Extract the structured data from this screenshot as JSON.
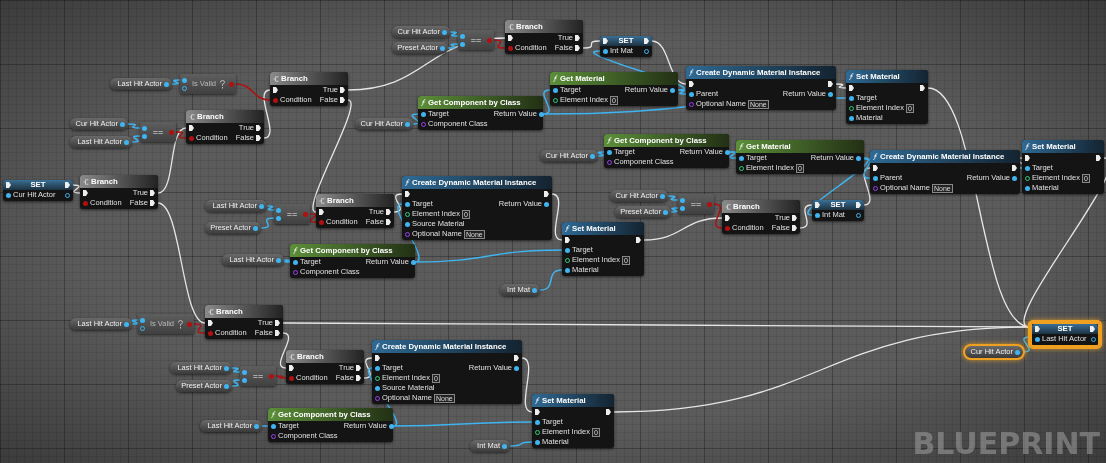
{
  "graph": {
    "nodes": [
      {
        "kind": "variable",
        "label": "Last Hit Actor",
        "selected": false
      },
      {
        "kind": "is_valid",
        "label": "Is Valid",
        "selected": false
      },
      {
        "kind": "variable",
        "label": "Cur Hit Actor",
        "selected": false
      },
      {
        "kind": "variable",
        "label": "Last Hit Actor",
        "selected": false
      },
      {
        "kind": "compare",
        "label": "==",
        "selected": false
      },
      {
        "kind": "branch",
        "title": "Branch",
        "condition": "Condition",
        "true": "True",
        "false": "False",
        "selected": false
      },
      {
        "kind": "branch",
        "title": "Branch",
        "condition": "Condition",
        "true": "True",
        "false": "False",
        "selected": false
      },
      {
        "kind": "set",
        "title": "SET",
        "pin": "Cur Hit Actor",
        "selected": false
      },
      {
        "kind": "branch",
        "title": "Branch",
        "condition": "Condition",
        "true": "True",
        "false": "False",
        "selected": false
      },
      {
        "kind": "variable",
        "label": "Cur Hit Actor",
        "selected": false
      },
      {
        "kind": "variable",
        "label": "Preset Actor",
        "selected": false
      },
      {
        "kind": "compare",
        "label": "==",
        "selected": false
      },
      {
        "kind": "branch",
        "title": "Branch",
        "condition": "Condition",
        "true": "True",
        "false": "False",
        "selected": false
      },
      {
        "kind": "set",
        "title": "SET",
        "pin": "Int Mat",
        "selected": false
      },
      {
        "kind": "variable",
        "label": "Cur Hit Actor",
        "selected": false
      },
      {
        "kind": "function",
        "title": "Get Component by Class",
        "pure": true,
        "selected": false,
        "inputs": [
          {
            "label": "Target",
            "kind": "object"
          },
          {
            "label": "Component Class",
            "kind": "class"
          }
        ],
        "outputs": [
          {
            "label": "Return Value",
            "kind": "object"
          }
        ]
      },
      {
        "kind": "function",
        "title": "Get Material",
        "pure": true,
        "selected": false,
        "inputs": [
          {
            "label": "Target",
            "kind": "object"
          },
          {
            "label": "Element Index",
            "kind": "int",
            "value": "0"
          }
        ],
        "outputs": [
          {
            "label": "Return Value",
            "kind": "object"
          }
        ]
      },
      {
        "kind": "function",
        "title": "Create Dynamic Material Instance",
        "pure": false,
        "selected": false,
        "inputs": [
          {
            "label": "Parent",
            "kind": "object"
          },
          {
            "label": "Optional Name",
            "kind": "name",
            "value": "None"
          }
        ],
        "outputs": [
          {
            "label": "Return Value",
            "kind": "object"
          }
        ]
      },
      {
        "kind": "function",
        "title": "Set Material",
        "pure": false,
        "selected": false,
        "inputs": [
          {
            "label": "Target",
            "kind": "object"
          },
          {
            "label": "Element Index",
            "kind": "int",
            "value": "0"
          },
          {
            "label": "Material",
            "kind": "object"
          }
        ]
      },
      {
        "kind": "variable",
        "label": "Cur Hit Actor",
        "selected": false
      },
      {
        "kind": "function",
        "title": "Get Component by Class",
        "pure": true,
        "selected": false,
        "inputs": [
          {
            "label": "Target",
            "kind": "object"
          },
          {
            "label": "Component Class",
            "kind": "class"
          }
        ],
        "outputs": [
          {
            "label": "Return Value",
            "kind": "object"
          }
        ]
      },
      {
        "kind": "function",
        "title": "Get Material",
        "pure": true,
        "selected": false,
        "inputs": [
          {
            "label": "Target",
            "kind": "object"
          },
          {
            "label": "Element Index",
            "kind": "int",
            "value": "0"
          }
        ],
        "outputs": [
          {
            "label": "Return Value",
            "kind": "object"
          }
        ]
      },
      {
        "kind": "variable",
        "label": "Cur Hit Actor",
        "selected": false
      },
      {
        "kind": "variable",
        "label": "Preset Actor",
        "selected": false
      },
      {
        "kind": "compare",
        "label": "==",
        "selected": false
      },
      {
        "kind": "branch",
        "title": "Branch",
        "condition": "Condition",
        "true": "True",
        "false": "False",
        "selected": false
      },
      {
        "kind": "set",
        "title": "SET",
        "pin": "Int Mat",
        "selected": false
      },
      {
        "kind": "function",
        "title": "Create Dynamic Material Instance",
        "pure": false,
        "selected": false,
        "inputs": [
          {
            "label": "Parent",
            "kind": "object"
          },
          {
            "label": "Optional Name",
            "kind": "name",
            "value": "None"
          }
        ],
        "outputs": [
          {
            "label": "Return Value",
            "kind": "object"
          }
        ]
      },
      {
        "kind": "function",
        "title": "Set Material",
        "pure": false,
        "selected": false,
        "inputs": [
          {
            "label": "Target",
            "kind": "object"
          },
          {
            "label": "Element Index",
            "kind": "int",
            "value": "0"
          },
          {
            "label": "Material",
            "kind": "object"
          }
        ]
      },
      {
        "kind": "variable",
        "label": "Last Hit Actor",
        "selected": false
      },
      {
        "kind": "variable",
        "label": "Preset Actor",
        "selected": false
      },
      {
        "kind": "compare",
        "label": "==",
        "selected": false
      },
      {
        "kind": "branch",
        "title": "Branch",
        "condition": "Condition",
        "true": "True",
        "false": "False",
        "selected": false
      },
      {
        "kind": "variable",
        "label": "Last Hit Actor",
        "selected": false
      },
      {
        "kind": "function",
        "title": "Get Component by Class",
        "pure": true,
        "selected": false,
        "inputs": [
          {
            "label": "Target",
            "kind": "object"
          },
          {
            "label": "Component Class",
            "kind": "class"
          }
        ],
        "outputs": [
          {
            "label": "Return Value",
            "kind": "object"
          }
        ]
      },
      {
        "kind": "function",
        "title": "Create Dynamic Material Instance",
        "pure": false,
        "selected": false,
        "inputs": [
          {
            "label": "Target",
            "kind": "object"
          },
          {
            "label": "Element Index",
            "kind": "int",
            "value": "0"
          },
          {
            "label": "Source Material",
            "kind": "object"
          },
          {
            "label": "Optional Name",
            "kind": "name",
            "value": "None"
          }
        ],
        "outputs": [
          {
            "label": "Return Value",
            "kind": "object"
          }
        ]
      },
      {
        "kind": "function",
        "title": "Set Material",
        "pure": false,
        "selected": false,
        "inputs": [
          {
            "label": "Target",
            "kind": "object"
          },
          {
            "label": "Element Index",
            "kind": "int",
            "value": "0"
          },
          {
            "label": "Material",
            "kind": "object"
          }
        ]
      },
      {
        "kind": "variable",
        "label": "Int Mat",
        "selected": false
      },
      {
        "kind": "variable",
        "label": "Last Hit Actor",
        "selected": false
      },
      {
        "kind": "is_valid",
        "label": "Is Valid",
        "selected": false
      },
      {
        "kind": "branch",
        "title": "Branch",
        "condition": "Condition",
        "true": "True",
        "false": "False",
        "selected": false
      },
      {
        "kind": "variable",
        "label": "Last Hit Actor",
        "selected": false
      },
      {
        "kind": "variable",
        "label": "Preset Actor",
        "selected": false
      },
      {
        "kind": "compare",
        "label": "==",
        "selected": false
      },
      {
        "kind": "branch",
        "title": "Branch",
        "condition": "Condition",
        "true": "True",
        "false": "False",
        "selected": false
      },
      {
        "kind": "function",
        "title": "Create Dynamic Material Instance",
        "pure": false,
        "selected": false,
        "inputs": [
          {
            "label": "Target",
            "kind": "object"
          },
          {
            "label": "Element Index",
            "kind": "int",
            "value": "0"
          },
          {
            "label": "Source Material",
            "kind": "object"
          },
          {
            "label": "Optional Name",
            "kind": "name",
            "value": "None"
          }
        ],
        "outputs": [
          {
            "label": "Return Value",
            "kind": "object"
          }
        ]
      },
      {
        "kind": "variable",
        "label": "Last Hit Actor",
        "selected": false
      },
      {
        "kind": "function",
        "title": "Get Component by Class",
        "pure": true,
        "selected": false,
        "inputs": [
          {
            "label": "Target",
            "kind": "object"
          },
          {
            "label": "Component Class",
            "kind": "class"
          }
        ],
        "outputs": [
          {
            "label": "Return Value",
            "kind": "object"
          }
        ]
      },
      {
        "kind": "function",
        "title": "Set Material",
        "pure": false,
        "selected": false,
        "inputs": [
          {
            "label": "Target",
            "kind": "object"
          },
          {
            "label": "Element Index",
            "kind": "int",
            "value": "0"
          },
          {
            "label": "Material",
            "kind": "object"
          }
        ]
      },
      {
        "kind": "variable",
        "label": "Int Mat",
        "selected": false
      },
      {
        "kind": "set",
        "title": "SET",
        "pin": "Last Hit Actor",
        "selected": true
      },
      {
        "kind": "variable",
        "label": "Cur Hit Actor",
        "selected": true
      }
    ],
    "graph_label": "BLUEPRINT"
  }
}
